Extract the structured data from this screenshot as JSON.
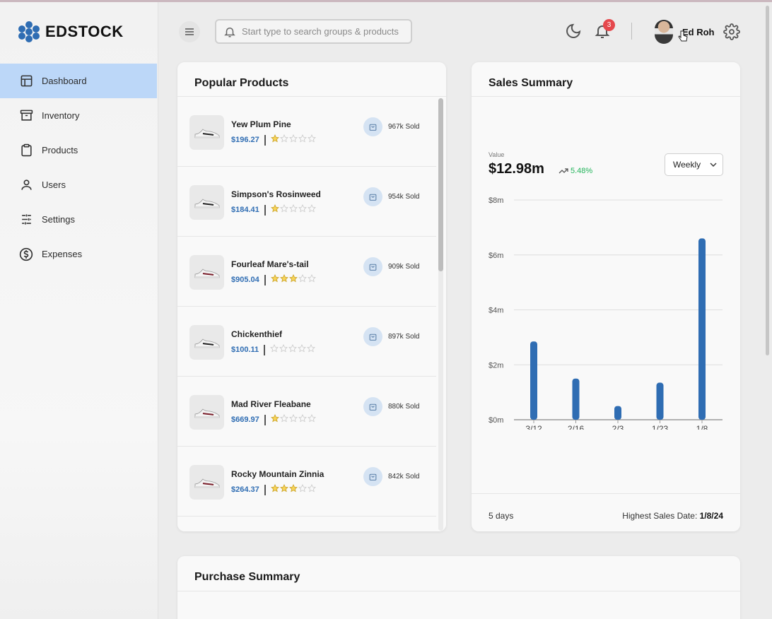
{
  "app": {
    "name": "EDSTOCK",
    "brand_color": "#2f6db3"
  },
  "sidebar": {
    "items": [
      {
        "label": "Dashboard",
        "icon": "layout-icon",
        "active": true
      },
      {
        "label": "Inventory",
        "icon": "archive-icon"
      },
      {
        "label": "Products",
        "icon": "clipboard-icon"
      },
      {
        "label": "Users",
        "icon": "user-icon"
      },
      {
        "label": "Settings",
        "icon": "sliders-icon"
      },
      {
        "label": "Expenses",
        "icon": "dollar-circle-icon"
      }
    ]
  },
  "header": {
    "search_placeholder": "Start type to search groups & products",
    "notification_count": "3",
    "user_name": "Ed Roh"
  },
  "popular_products": {
    "title": "Popular Products",
    "items": [
      {
        "name": "Yew Plum Pine",
        "price": "$196.27",
        "rating": 1,
        "sold": "967k Sold",
        "shoe": "black"
      },
      {
        "name": "Simpson's Rosinweed",
        "price": "$184.41",
        "rating": 1,
        "sold": "954k Sold",
        "shoe": "black"
      },
      {
        "name": "Fourleaf Mare's-tail",
        "price": "$905.04",
        "rating": 3,
        "sold": "909k Sold",
        "shoe": "maroon"
      },
      {
        "name": "Chickenthief",
        "price": "$100.11",
        "rating": 0,
        "sold": "897k Sold",
        "shoe": "black"
      },
      {
        "name": "Mad River Fleabane",
        "price": "$669.97",
        "rating": 1,
        "sold": "880k Sold",
        "shoe": "maroon"
      },
      {
        "name": "Rocky Mountain Zinnia",
        "price": "$264.37",
        "rating": 3,
        "sold": "842k Sold",
        "shoe": "maroon"
      }
    ]
  },
  "sales_summary": {
    "title": "Sales Summary",
    "value_label": "Value",
    "value": "$12.98m",
    "change": "5.48%",
    "period": "Weekly",
    "footer_left": "5 days",
    "footer_right_label": "Highest Sales Date:",
    "footer_right_value": "1/8/24"
  },
  "purchase_summary": {
    "title": "Purchase Summary"
  },
  "chart_data": {
    "type": "bar",
    "categories": [
      "3/12",
      "2/16",
      "2/3",
      "1/23",
      "1/8"
    ],
    "values": [
      2.85,
      1.5,
      0.5,
      1.35,
      6.6
    ],
    "unit": "millions USD",
    "yticks": [
      "$0m",
      "$2m",
      "$4m",
      "$6m",
      "$8m"
    ],
    "ylim": [
      0,
      8
    ],
    "grid": true,
    "bar_color": "#2f6db3"
  }
}
